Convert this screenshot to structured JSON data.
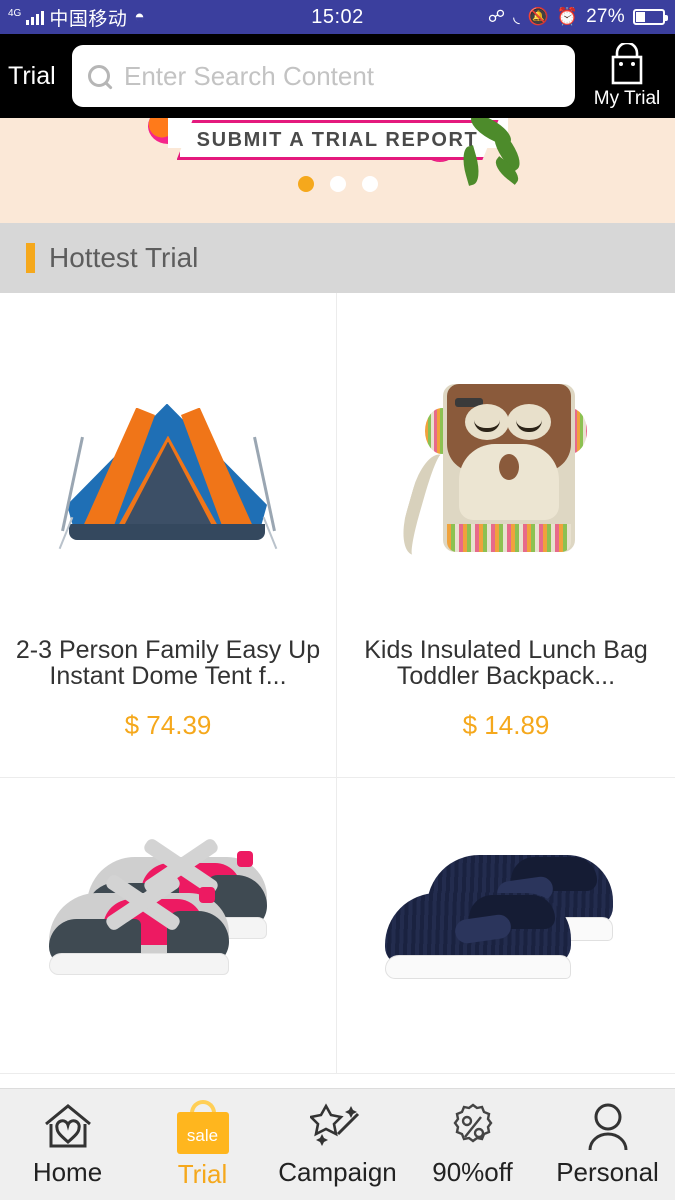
{
  "status_bar": {
    "network_type": "4G",
    "carrier": "中国移动",
    "wifi_icon": "wifi-icon",
    "time": "15:02",
    "bluetooth_icon": "bluetooth-icon",
    "headphone_icon": "headphone-icon",
    "mute_icon": "mute-icon",
    "alarm_icon": "alarm-icon",
    "battery_percent": "27%",
    "background_color": "#3b3f9e"
  },
  "header": {
    "brand": "Trial",
    "search": {
      "placeholder": "Enter Search Content",
      "value": "",
      "icon": "search-icon"
    },
    "my_trial": {
      "label": "My Trial",
      "icon": "shopping-bag-icon"
    },
    "background_color": "#000000"
  },
  "banner": {
    "ribbon_text": "SUBMIT A TRIAL REPORT",
    "background_color": "#fbe8d7",
    "frame_color": "#e4197d",
    "dots": [
      {
        "active": true
      },
      {
        "active": false
      },
      {
        "active": false
      }
    ],
    "active_dot_color": "#f5a81c"
  },
  "section": {
    "title": "Hottest Trial",
    "accent_color": "#f5a81c",
    "background_color": "#d7d7d7"
  },
  "products": [
    {
      "title": "2-3 Person Family Easy Up Instant Dome Tent f...",
      "price": "$ 74.39",
      "image": "dome-tent-photo"
    },
    {
      "title": "Kids Insulated Lunch Bag Toddler Backpack...",
      "price": "$ 14.89",
      "image": "monkey-lunch-bag-photo"
    },
    {
      "title": "",
      "price": "",
      "image": "gray-pink-mary-jane-shoes-photo"
    },
    {
      "title": "",
      "price": "",
      "image": "navy-slip-on-shoes-photo"
    }
  ],
  "price_color": "#f5a81c",
  "tabbar": {
    "items": [
      {
        "label": "Home",
        "icon": "home-heart-icon",
        "active": false
      },
      {
        "label": "Trial",
        "icon": "sale-bag-icon",
        "icon_text": "sale",
        "active": true
      },
      {
        "label": "Campaign",
        "icon": "magic-wand-icon",
        "active": false
      },
      {
        "label": "90%off",
        "icon": "percent-badge-icon",
        "active": false
      },
      {
        "label": "Personal",
        "icon": "person-icon",
        "active": false
      }
    ],
    "active_color": "#f5a81c",
    "background_color": "#efefef"
  }
}
